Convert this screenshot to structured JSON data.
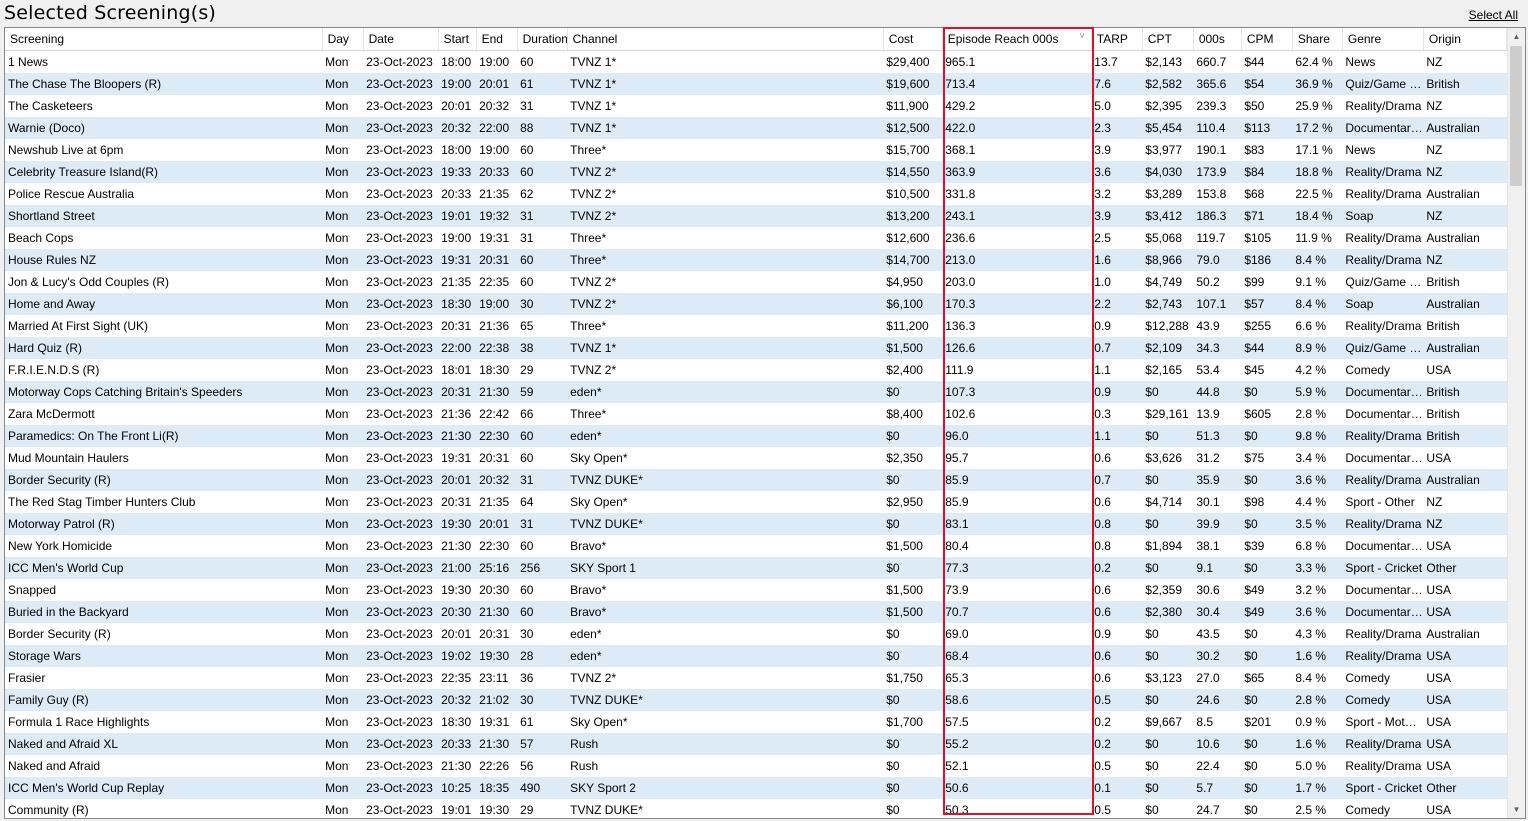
{
  "title": "Selected Screening(s)",
  "select_all_label": "Select All",
  "highlight_color": "#e0102a",
  "sorted_column_indicator": "sort-descending-icon",
  "columns": [
    "Screening",
    "Day",
    "Date",
    "Start",
    "End",
    "Duration",
    "Channel",
    "Cost",
    "Episode Reach 000s",
    "TARP",
    "CPT",
    "000s",
    "CPM",
    "Share",
    "Genre",
    "Origin"
  ],
  "rows": [
    [
      "1 News",
      "Mon",
      "23-Oct-2023",
      "18:00",
      "19:00",
      "60",
      "TVNZ 1*",
      "$29,400",
      "965.1",
      "13.7",
      "$2,143",
      "660.7",
      "$44",
      "62.4 %",
      "News",
      "NZ"
    ],
    [
      "The Chase The Bloopers (R)",
      "Mon",
      "23-Oct-2023",
      "19:00",
      "20:01",
      "61",
      "TVNZ 1*",
      "$19,600",
      "713.4",
      "7.6",
      "$2,582",
      "365.6",
      "$54",
      "36.9 %",
      "Quiz/Game S...",
      "British"
    ],
    [
      "The Casketeers",
      "Mon",
      "23-Oct-2023",
      "20:01",
      "20:32",
      "31",
      "TVNZ 1*",
      "$11,900",
      "429.2",
      "5.0",
      "$2,395",
      "239.3",
      "$50",
      "25.9 %",
      "Reality/Drama",
      "NZ"
    ],
    [
      "Warnie (Doco)",
      "Mon",
      "23-Oct-2023",
      "20:32",
      "22:00",
      "88",
      "TVNZ 1*",
      "$12,500",
      "422.0",
      "2.3",
      "$5,454",
      "110.4",
      "$113",
      "17.2 %",
      "Documentary...",
      "Australian"
    ],
    [
      "Newshub Live at 6pm",
      "Mon",
      "23-Oct-2023",
      "18:00",
      "19:00",
      "60",
      "Three*",
      "$15,700",
      "368.1",
      "3.9",
      "$3,977",
      "190.1",
      "$83",
      "17.1 %",
      "News",
      "NZ"
    ],
    [
      "Celebrity Treasure Island(R)",
      "Mon",
      "23-Oct-2023",
      "19:33",
      "20:33",
      "60",
      "TVNZ 2*",
      "$14,550",
      "363.9",
      "3.6",
      "$4,030",
      "173.9",
      "$84",
      "18.8 %",
      "Reality/Drama",
      "NZ"
    ],
    [
      "Police Rescue Australia",
      "Mon",
      "23-Oct-2023",
      "20:33",
      "21:35",
      "62",
      "TVNZ 2*",
      "$10,500",
      "331.8",
      "3.2",
      "$3,289",
      "153.8",
      "$68",
      "22.5 %",
      "Reality/Drama",
      "Australian"
    ],
    [
      "Shortland Street",
      "Mon",
      "23-Oct-2023",
      "19:01",
      "19:32",
      "31",
      "TVNZ 2*",
      "$13,200",
      "243.1",
      "3.9",
      "$3,412",
      "186.3",
      "$71",
      "18.4 %",
      "Soap",
      "NZ"
    ],
    [
      "Beach Cops",
      "Mon",
      "23-Oct-2023",
      "19:00",
      "19:31",
      "31",
      "Three*",
      "$12,600",
      "236.6",
      "2.5",
      "$5,068",
      "119.7",
      "$105",
      "11.9 %",
      "Reality/Drama",
      "Australian"
    ],
    [
      "House Rules NZ",
      "Mon",
      "23-Oct-2023",
      "19:31",
      "20:31",
      "60",
      "Three*",
      "$14,700",
      "213.0",
      "1.6",
      "$8,966",
      "79.0",
      "$186",
      "8.4 %",
      "Reality/Drama",
      "NZ"
    ],
    [
      "Jon & Lucy's Odd Couples (R)",
      "Mon",
      "23-Oct-2023",
      "21:35",
      "22:35",
      "60",
      "TVNZ 2*",
      "$4,950",
      "203.0",
      "1.0",
      "$4,749",
      "50.2",
      "$99",
      "9.1 %",
      "Quiz/Game S...",
      "British"
    ],
    [
      "Home and Away",
      "Mon",
      "23-Oct-2023",
      "18:30",
      "19:00",
      "30",
      "TVNZ 2*",
      "$6,100",
      "170.3",
      "2.2",
      "$2,743",
      "107.1",
      "$57",
      "8.4 %",
      "Soap",
      "Australian"
    ],
    [
      "Married At First Sight (UK)",
      "Mon",
      "23-Oct-2023",
      "20:31",
      "21:36",
      "65",
      "Three*",
      "$11,200",
      "136.3",
      "0.9",
      "$12,288",
      "43.9",
      "$255",
      "6.6 %",
      "Reality/Drama",
      "British"
    ],
    [
      "Hard Quiz (R)",
      "Mon",
      "23-Oct-2023",
      "22:00",
      "22:38",
      "38",
      "TVNZ 1*",
      "$1,500",
      "126.6",
      "0.7",
      "$2,109",
      "34.3",
      "$44",
      "8.9 %",
      "Quiz/Game S...",
      "Australian"
    ],
    [
      "F.R.I.E.N.D.S (R)",
      "Mon",
      "23-Oct-2023",
      "18:01",
      "18:30",
      "29",
      "TVNZ 2*",
      "$2,400",
      "111.9",
      "1.1",
      "$2,165",
      "53.4",
      "$45",
      "4.2 %",
      "Comedy",
      "USA"
    ],
    [
      "Motorway Cops Catching Britain's Speeders",
      "Mon",
      "23-Oct-2023",
      "20:31",
      "21:30",
      "59",
      "eden*",
      "$0",
      "107.3",
      "0.9",
      "$0",
      "44.8",
      "$0",
      "5.9 %",
      "Documentary...",
      "British"
    ],
    [
      "Zara McDermott",
      "Mon",
      "23-Oct-2023",
      "21:36",
      "22:42",
      "66",
      "Three*",
      "$8,400",
      "102.6",
      "0.3",
      "$29,161",
      "13.9",
      "$605",
      "2.8 %",
      "Documentary...",
      "British"
    ],
    [
      "Paramedics: On The Front Li(R)",
      "Mon",
      "23-Oct-2023",
      "21:30",
      "22:30",
      "60",
      "eden*",
      "$0",
      "96.0",
      "1.1",
      "$0",
      "51.3",
      "$0",
      "9.8 %",
      "Reality/Drama",
      "British"
    ],
    [
      "Mud Mountain Haulers",
      "Mon",
      "23-Oct-2023",
      "19:31",
      "20:31",
      "60",
      "Sky Open*",
      "$2,350",
      "95.7",
      "0.6",
      "$3,626",
      "31.2",
      "$75",
      "3.4 %",
      "Documentary...",
      "USA"
    ],
    [
      "Border Security (R)",
      "Mon",
      "23-Oct-2023",
      "20:01",
      "20:32",
      "31",
      "TVNZ DUKE*",
      "$0",
      "85.9",
      "0.7",
      "$0",
      "35.9",
      "$0",
      "3.6 %",
      "Reality/Drama",
      "Australian"
    ],
    [
      "The Red Stag Timber Hunters Club",
      "Mon",
      "23-Oct-2023",
      "20:31",
      "21:35",
      "64",
      "Sky Open*",
      "$2,950",
      "85.9",
      "0.6",
      "$4,714",
      "30.1",
      "$98",
      "4.4 %",
      "Sport - Other",
      "NZ"
    ],
    [
      "Motorway Patrol (R)",
      "Mon",
      "23-Oct-2023",
      "19:30",
      "20:01",
      "31",
      "TVNZ DUKE*",
      "$0",
      "83.1",
      "0.8",
      "$0",
      "39.9",
      "$0",
      "3.5 %",
      "Reality/Drama",
      "NZ"
    ],
    [
      "New York Homicide",
      "Mon",
      "23-Oct-2023",
      "21:30",
      "22:30",
      "60",
      "Bravo*",
      "$1,500",
      "80.4",
      "0.8",
      "$1,894",
      "38.1",
      "$39",
      "6.8 %",
      "Documentary...",
      "USA"
    ],
    [
      "ICC Men's World Cup",
      "Mon",
      "23-Oct-2023",
      "21:00",
      "25:16",
      "256",
      "SKY Sport 1",
      "$0",
      "77.3",
      "0.2",
      "$0",
      "9.1",
      "$0",
      "3.3 %",
      "Sport - Cricket",
      "Other"
    ],
    [
      "Snapped",
      "Mon",
      "23-Oct-2023",
      "19:30",
      "20:30",
      "60",
      "Bravo*",
      "$1,500",
      "73.9",
      "0.6",
      "$2,359",
      "30.6",
      "$49",
      "3.2 %",
      "Documentary...",
      "USA"
    ],
    [
      "Buried in the Backyard",
      "Mon",
      "23-Oct-2023",
      "20:30",
      "21:30",
      "60",
      "Bravo*",
      "$1,500",
      "70.7",
      "0.6",
      "$2,380",
      "30.4",
      "$49",
      "3.6 %",
      "Documentary...",
      "USA"
    ],
    [
      "Border Security (R)",
      "Mon",
      "23-Oct-2023",
      "20:01",
      "20:31",
      "30",
      "eden*",
      "$0",
      "69.0",
      "0.9",
      "$0",
      "43.5",
      "$0",
      "4.3 %",
      "Reality/Drama",
      "Australian"
    ],
    [
      "Storage Wars",
      "Mon",
      "23-Oct-2023",
      "19:02",
      "19:30",
      "28",
      "eden*",
      "$0",
      "68.4",
      "0.6",
      "$0",
      "30.2",
      "$0",
      "1.6 %",
      "Reality/Drama",
      "USA"
    ],
    [
      "Frasier",
      "Mon",
      "23-Oct-2023",
      "22:35",
      "23:11",
      "36",
      "TVNZ 2*",
      "$1,750",
      "65.3",
      "0.6",
      "$3,123",
      "27.0",
      "$65",
      "8.4 %",
      "Comedy",
      "USA"
    ],
    [
      "Family Guy (R)",
      "Mon",
      "23-Oct-2023",
      "20:32",
      "21:02",
      "30",
      "TVNZ DUKE*",
      "$0",
      "58.6",
      "0.5",
      "$0",
      "24.6",
      "$0",
      "2.8 %",
      "Comedy",
      "USA"
    ],
    [
      "Formula 1 Race Highlights",
      "Mon",
      "23-Oct-2023",
      "18:30",
      "19:31",
      "61",
      "Sky Open*",
      "$1,700",
      "57.5",
      "0.2",
      "$9,667",
      "8.5",
      "$201",
      "0.9 %",
      "Sport - Motor...",
      "USA"
    ],
    [
      "Naked and Afraid XL",
      "Mon",
      "23-Oct-2023",
      "20:33",
      "21:30",
      "57",
      "Rush",
      "$0",
      "55.2",
      "0.2",
      "$0",
      "10.6",
      "$0",
      "1.6 %",
      "Reality/Drama",
      "USA"
    ],
    [
      "Naked and Afraid",
      "Mon",
      "23-Oct-2023",
      "21:30",
      "22:26",
      "56",
      "Rush",
      "$0",
      "52.1",
      "0.5",
      "$0",
      "22.4",
      "$0",
      "5.0 %",
      "Reality/Drama",
      "USA"
    ],
    [
      "ICC Men's World Cup Replay",
      "Mon",
      "23-Oct-2023",
      "10:25",
      "18:35",
      "490",
      "SKY Sport 2",
      "$0",
      "50.6",
      "0.1",
      "$0",
      "5.7",
      "$0",
      "1.7 %",
      "Sport - Cricket",
      "Other"
    ],
    [
      "Community (R)",
      "Mon",
      "23-Oct-2023",
      "19:01",
      "19:30",
      "29",
      "TVNZ DUKE*",
      "$0",
      "50.3",
      "0.5",
      "$0",
      "24.7",
      "$0",
      "2.5 %",
      "Comedy",
      "USA"
    ]
  ]
}
